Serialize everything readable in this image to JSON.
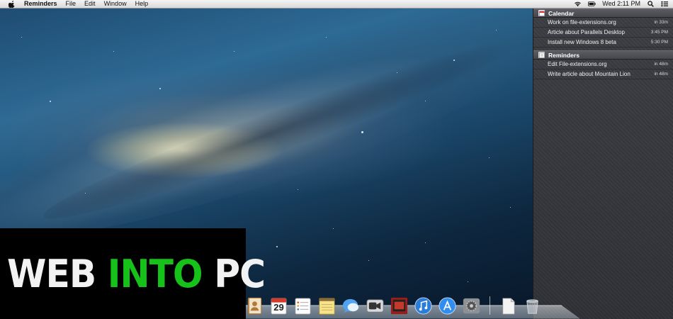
{
  "menubar": {
    "apple_icon": "apple-icon",
    "app_name": "Reminders",
    "menus": [
      "File",
      "Edit",
      "Window",
      "Help"
    ],
    "status": {
      "clock": "Wed 2:11 PM",
      "icons": [
        "wifi-icon",
        "battery-icon",
        "spotlight-search-icon",
        "notification-center-icon"
      ]
    }
  },
  "notification_center": {
    "calendar": {
      "header": "Calendar",
      "items": [
        {
          "title": "Work on file-extensions.org",
          "time": "in 33m"
        },
        {
          "title": "Article about Parallels Desktop",
          "time": "3:45 PM"
        },
        {
          "title": "Install new Windows 8 beta",
          "time": "5:30 PM"
        }
      ]
    },
    "reminders": {
      "header": "Reminders",
      "items": [
        {
          "title": "Edit File-extensions.org",
          "time": "in 48m"
        },
        {
          "title": "Write article about Mountain Lion",
          "time": "in 48m"
        }
      ]
    }
  },
  "watermark": {
    "part1": "WEB ",
    "part2": "INTO",
    "part3": " PC"
  },
  "dock": {
    "calendar_day": "29",
    "items": [
      "contacts-icon",
      "calendar-icon",
      "reminders-icon",
      "notes-icon",
      "messages-icon",
      "facetime-icon",
      "photo-booth-icon",
      "itunes-icon",
      "app-store-icon",
      "system-preferences-icon",
      "documents-icon",
      "trash-icon"
    ]
  },
  "colors": {
    "watermark_green": "#16c21a",
    "notification_bg": "#34363b",
    "menubar_bg": "#e8e8e8"
  }
}
